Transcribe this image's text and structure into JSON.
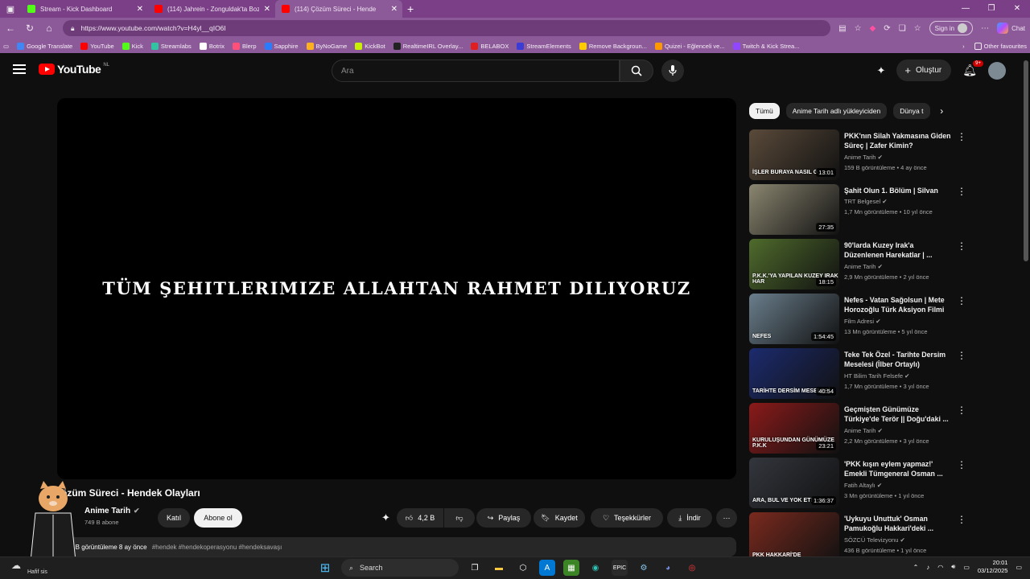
{
  "browser": {
    "tabs": [
      {
        "title": "Stream - Kick Dashboard",
        "favicon_color": "#53fc18",
        "active": false
      },
      {
        "title": "(114) Jahrein - Zonguldak'ta Bozu",
        "favicon_color": "#ff0000",
        "active": false
      },
      {
        "title": "(114) Çözüm Süreci - Hende",
        "favicon_color": "#ff0000",
        "active": true
      }
    ],
    "url": "https://www.youtube.com/watch?v=H4yl__qIO6I",
    "signin_label": "Sign in",
    "chat_label": "Chat",
    "bookmarks": [
      {
        "label": "Google Translate",
        "color": "#4285f4"
      },
      {
        "label": "YouTube",
        "color": "#ff0000"
      },
      {
        "label": "Kick",
        "color": "#53fc18"
      },
      {
        "label": "Streamlabs",
        "color": "#31c3a2"
      },
      {
        "label": "Botrix",
        "color": "#ffffff"
      },
      {
        "label": "Blerp",
        "color": "#ff4f7b"
      },
      {
        "label": "Sapphire",
        "color": "#2b7bff"
      },
      {
        "label": "ByNoGame",
        "color": "#ffb020"
      },
      {
        "label": "KickBot",
        "color": "#c8f000"
      },
      {
        "label": "RealtimeIRL Overlay...",
        "color": "#222222"
      },
      {
        "label": "BELABOX",
        "color": "#e02020"
      },
      {
        "label": "StreamElements",
        "color": "#3b3bd6"
      },
      {
        "label": "Remove Backgroun...",
        "color": "#ffcc00"
      },
      {
        "label": "Quizei - Eğlenceli ve...",
        "color": "#ff9900"
      },
      {
        "label": "Twitch & Kick Strea...",
        "color": "#9146ff"
      }
    ],
    "other_favourites": "Other favourites"
  },
  "youtube": {
    "logo_text": "YouTube",
    "region": "NL",
    "search_placeholder": "Ara",
    "create_label": "Oluştur",
    "notif_count": "9+",
    "player_overlay_text": "TÜM ŞEHITLERIMIZE ALLAHTAN RAHMET DILIYORUZ",
    "video_title": "özüm Süreci - Hendek Olayları",
    "channel_name": "Anime Tarih",
    "subscribers": "749 B abone",
    "join_label": "Katıl",
    "subscribe_label": "Abone ol",
    "likes": "4,2 B",
    "share_label": "Paylaş",
    "save_label": "Kaydet",
    "thanks_label": "Teşekkürler",
    "download_label": "İndir",
    "views_date": "8 B görüntüleme  8 ay önce",
    "hashtags": "#hendek #hendekoperasyonu #hendeksavaşı",
    "chips": [
      "Tümü",
      "Anime Tarih adlı yükleyiciden",
      "Dünya t"
    ],
    "recommendations": [
      {
        "title": "PKK'nın Silah Yakmasına Giden Süreç | Zafer Kimin?",
        "channel": "Anime Tarih",
        "verified": true,
        "meta": "159 B görüntüleme • 4 ay önce",
        "duration": "13:01",
        "caption": "İŞLER BURAYA NASIL G",
        "thumb_color": "#5a4a3a"
      },
      {
        "title": "Şahit Olun 1. Bölüm | Silvan",
        "channel": "TRT Belgesel",
        "verified": true,
        "meta": "1,7 Mn görüntüleme • 10 yıl önce",
        "duration": "27:35",
        "caption": "",
        "thumb_color": "#8a8670"
      },
      {
        "title": "90'larda Kuzey Irak'a Düzenlenen Harekatlar | ...",
        "channel": "Anime Tarih",
        "verified": true,
        "meta": "2,9 Mn görüntüleme • 2 yıl önce",
        "duration": "18:15",
        "caption": "P.K.K.'YA YAPILAN KUZEY IRAK HAR",
        "thumb_color": "#4f6b2c"
      },
      {
        "title": "Nefes - Vatan Sağolsun | Mete Horozoğlu Türk Aksiyon Filmi",
        "channel": "Film Adresi",
        "verified": true,
        "meta": "13 Mn görüntüleme • 5 yıl önce",
        "duration": "1:54:45",
        "caption": "NEFES",
        "thumb_color": "#6a7e8c"
      },
      {
        "title": "Teke Tek Özel - Tarihte Dersim Meselesi (İlber Ortaylı)",
        "channel": "HT Bilim Tarih Felsefe",
        "verified": true,
        "meta": "1,7 Mn görüntüleme • 3 yıl önce",
        "duration": "40:54",
        "caption": "TARİHTE DERSİM MESELESİ",
        "thumb_color": "#1c2b6e"
      },
      {
        "title": "Geçmişten Günümüze Türkiye'de Terör || Doğu'daki ...",
        "channel": "Anime Tarih",
        "verified": true,
        "meta": "2,2 Mn görüntüleme • 3 yıl önce",
        "duration": "23:21",
        "caption": "KURULUŞUNDAN GÜNÜMÜZE P.K.K",
        "thumb_color": "#8b1a1a"
      },
      {
        "title": "'PKK kışın eylem yapmaz!' Emekli Tümgeneral Osman ...",
        "channel": "Fatih Altaylı",
        "verified": true,
        "meta": "3 Mn görüntüleme • 1 yıl önce",
        "duration": "1:36:37",
        "caption": "ARA, BUL VE YOK ET!",
        "thumb_color": "#33363d"
      },
      {
        "title": "'Uykuyu Unuttuk' Osman Pamukoğlu Hakkari'deki ...",
        "channel": "SÖZCÜ Televizyonu",
        "verified": true,
        "meta": "436 B görüntüleme • 1 yıl önce",
        "duration": "",
        "caption": "PKK HAKKARİ'DE",
        "thumb_color": "#7a2a1e"
      }
    ]
  },
  "taskbar": {
    "search_label": "Search",
    "weather": "Hafif sis",
    "time": "20:01",
    "date": "03/12/2025"
  }
}
